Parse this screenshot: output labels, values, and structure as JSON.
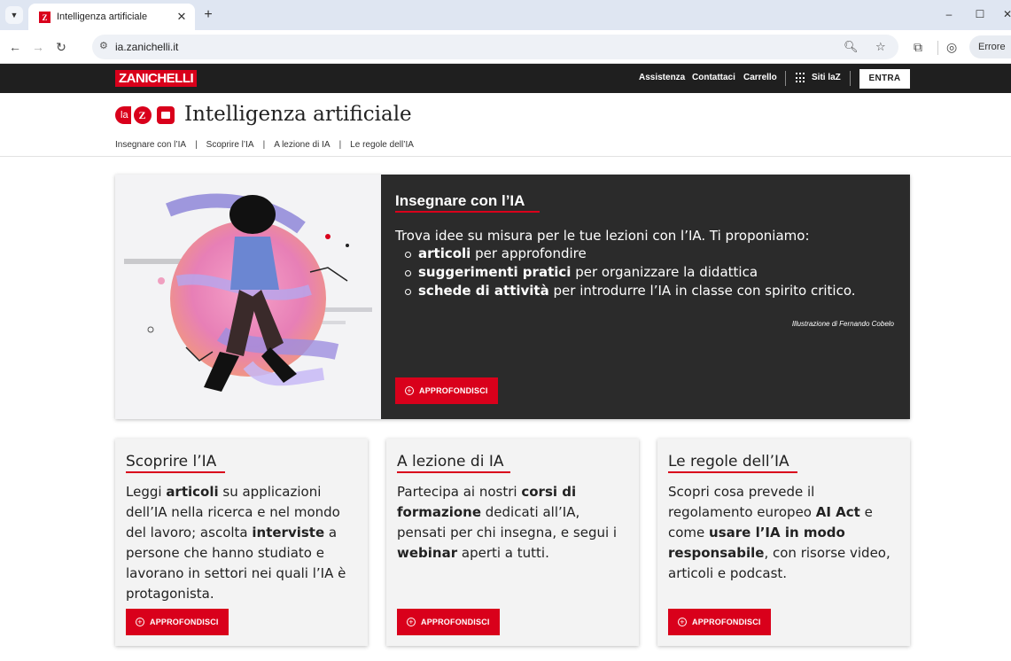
{
  "browser": {
    "tab_title": "Intelligenza artificiale",
    "url": "ia.zanichelli.it",
    "profile_status": "Errore"
  },
  "header": {
    "logo": "ZANICHELLI",
    "links": [
      "Assistenza",
      "Contattaci",
      "Carrello"
    ],
    "sites_label": "Siti laZ",
    "login_label": "ENTRA"
  },
  "title_area": {
    "badge_la": "la",
    "badge_z": "Z",
    "title": "Intelligenza artificiale",
    "subnav": [
      "Insegnare con l’IA",
      "Scoprire l’IA",
      "A lezione di IA",
      "Le regole dell’IA"
    ],
    "subnav_separator": "|"
  },
  "hero": {
    "title": "Insegnare con l’IA",
    "intro": "Trova idee su misura per le tue lezioni con l’IA. Ti proponiamo:",
    "items": [
      {
        "bold": "articoli",
        "rest": " per approfondire"
      },
      {
        "bold": "suggerimenti pratici",
        "rest": " per organizzare la didattica"
      },
      {
        "bold": "schede di attività",
        "rest": " per introdurre l’IA in classe con spirito critico."
      }
    ],
    "credit": "Illustrazione di Fernando Cobelo",
    "button": "APPROFONDISCI"
  },
  "cards": [
    {
      "title": "Scoprire l’IA",
      "text": [
        {
          "t": "Leggi ",
          "b": false
        },
        {
          "t": "articoli",
          "b": true
        },
        {
          "t": " su applicazioni dell’IA nella ricerca e nel mondo del lavoro; ascolta ",
          "b": false
        },
        {
          "t": "interviste",
          "b": true
        },
        {
          "t": " a persone che hanno studiato e lavorano in settori nei quali l’IA è protagonista.",
          "b": false
        }
      ],
      "button": "APPROFONDISCI"
    },
    {
      "title": "A lezione di IA",
      "text": [
        {
          "t": "Partecipa ai nostri ",
          "b": false
        },
        {
          "t": "corsi di formazione",
          "b": true
        },
        {
          "t": " dedicati all’IA, pensati per chi insegna, e segui i ",
          "b": false
        },
        {
          "t": "webinar",
          "b": true
        },
        {
          "t": " aperti a tutti.",
          "b": false
        }
      ],
      "button": "APPROFONDISCI"
    },
    {
      "title": "Le regole dell’IA",
      "text": [
        {
          "t": "Scopri cosa prevede il regolamento europeo ",
          "b": false
        },
        {
          "t": "AI Act",
          "b": true
        },
        {
          "t": " e come ",
          "b": false
        },
        {
          "t": "usare l’IA in modo responsabile",
          "b": true
        },
        {
          "t": ", con risorse video, articoli e podcast.",
          "b": false
        }
      ],
      "button": "APPROFONDISCI"
    }
  ],
  "colors": {
    "brand_red": "#d9001b",
    "header_dark": "#1f1f1f",
    "hero_dark": "#2b2b2b",
    "card_bg": "#f3f3f3"
  }
}
